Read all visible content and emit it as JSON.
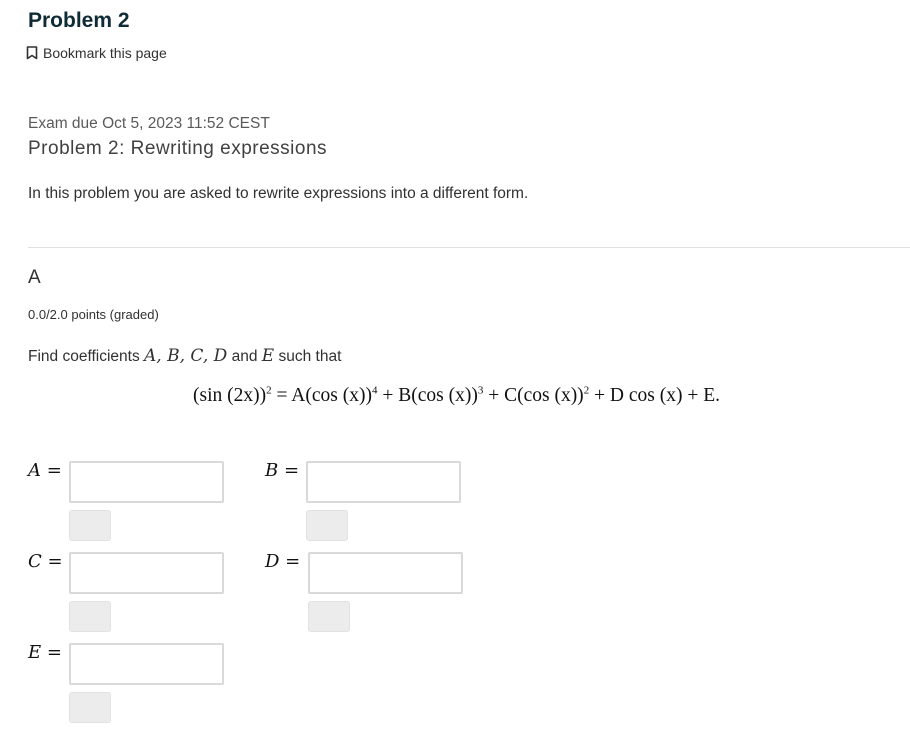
{
  "page_title": "Problem 2",
  "bookmark": {
    "label": "Bookmark this page",
    "icon": "bookmark-icon"
  },
  "exam_due": "Exam due Oct 5, 2023 11:52 CEST",
  "problem_heading": "Problem 2: Rewriting expressions",
  "intro": "In this problem you are asked to rewrite expressions into a different form.",
  "section": {
    "label": "A",
    "points": "0.0/2.0 points (graded)",
    "prompt": {
      "prefix": "Find coefficients ",
      "vars": "A, B, C, D",
      "and": " and ",
      "last_var": "E",
      "suffix": " such that"
    },
    "equation": {
      "lhs": "(sin (2x))",
      "lhs_exp": "2",
      "eq": " = ",
      "t1": "A(cos (x))",
      "t1_exp": "4",
      "t2": " + B(cos (x))",
      "t2_exp": "3",
      "t3": " + C(cos (x))",
      "t3_exp": "2",
      "t4": " + D cos (x) + E."
    },
    "fields": [
      {
        "var": "A",
        "eq": " =",
        "value": ""
      },
      {
        "var": "B",
        "eq": " =",
        "value": ""
      },
      {
        "var": "C",
        "eq": " =",
        "value": ""
      },
      {
        "var": "D",
        "eq": " =",
        "value": ""
      },
      {
        "var": "E",
        "eq": " =",
        "value": ""
      }
    ]
  }
}
